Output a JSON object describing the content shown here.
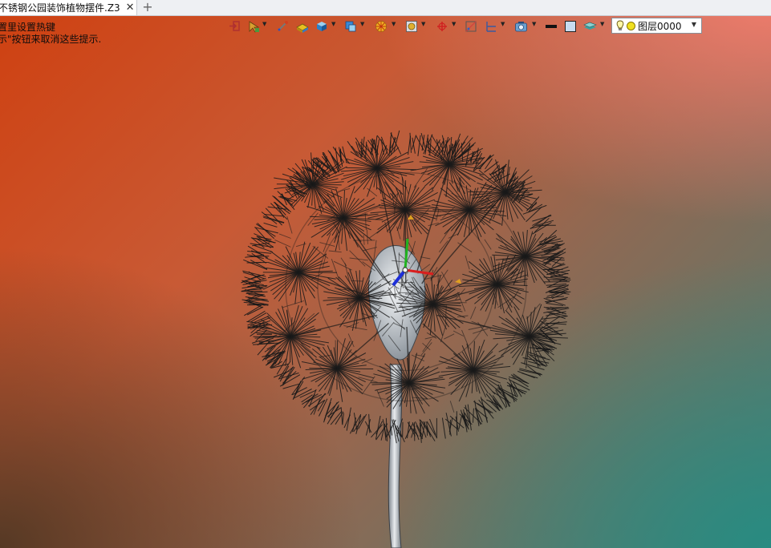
{
  "document_tab": {
    "title": "不锈钢公园装饰植物摆件.Z3",
    "close_symbol": "✕",
    "add_symbol": "+"
  },
  "hints": [
    "置里设置热键",
    "示\"按钮来取消这些提示."
  ],
  "toolbar": {
    "icons": [
      "exit-icon",
      "pick-filter-icon",
      "snap-icon",
      "shade-mode-icon",
      "solid-view-icon",
      "view-orient-icon",
      "display-icon",
      "render-icon",
      "triad-icon",
      "section-icon",
      "grid-icon",
      "camera-icon",
      "line-style-swatch",
      "color-swatch",
      "layer-manager-icon"
    ],
    "layer": {
      "name": "图层0000",
      "light_color": "#f0e020"
    }
  },
  "colors": {
    "gradient_top_left": "#cf4010",
    "gradient_top_right": "#f57d6e",
    "gradient_bottom_left": "#50372f",
    "gradient_bottom_right": "#268c82",
    "wire": "#1a1a1a",
    "stem": "#c8ccd2"
  }
}
